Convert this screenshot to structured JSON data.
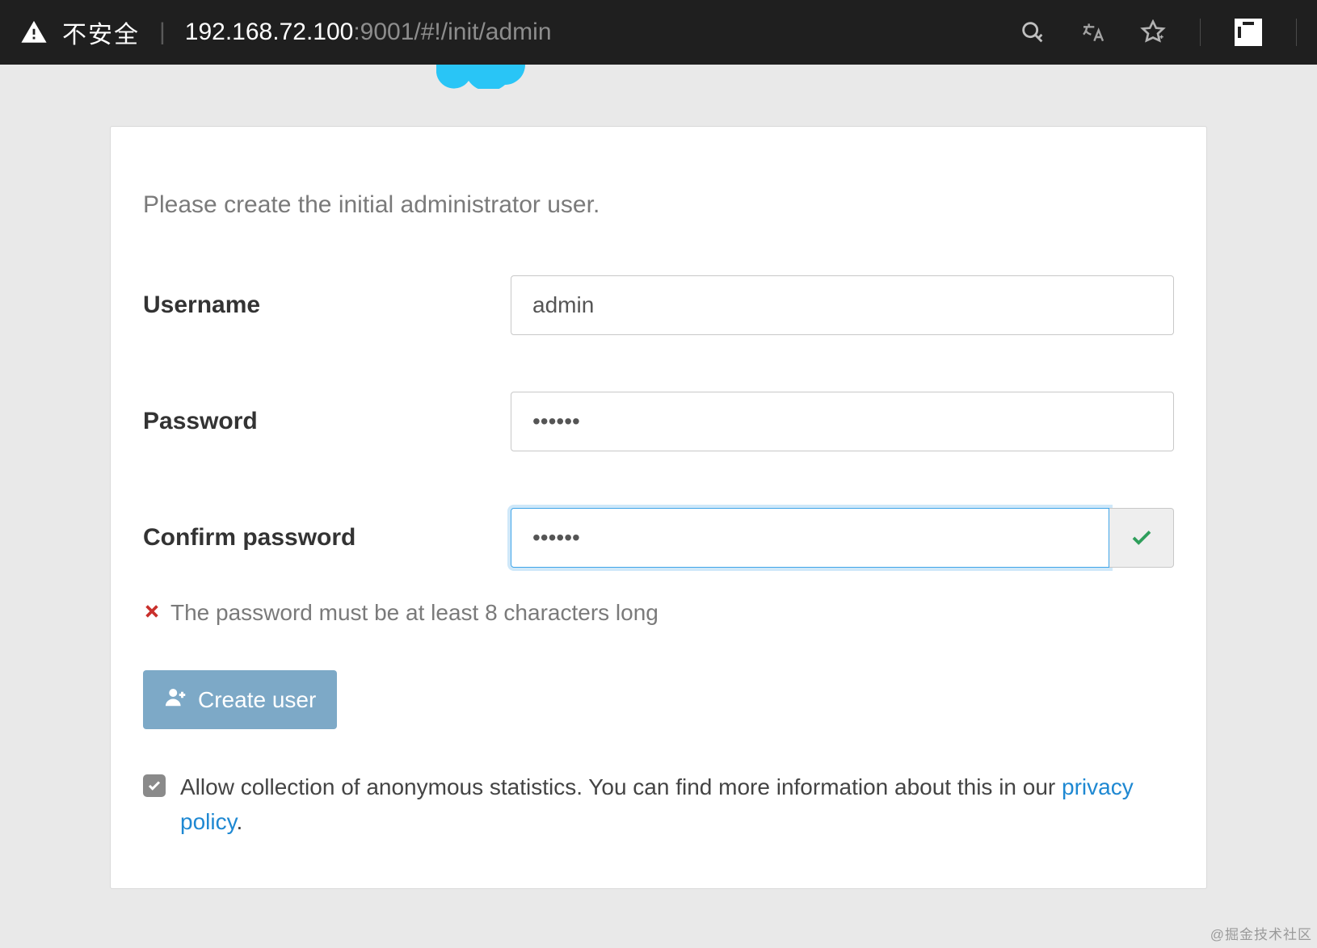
{
  "browser": {
    "security_label": "不安全",
    "url_host": "192.168.72.100",
    "url_port_path": ":9001/#!/init/admin"
  },
  "form": {
    "intro": "Please create the initial administrator user.",
    "username_label": "Username",
    "username_value": "admin",
    "password_label": "Password",
    "password_value": "••••••",
    "confirm_label": "Confirm password",
    "confirm_value": "••••••",
    "error_text": "The password must be at least 8 characters long",
    "submit_label": "Create user",
    "stats_text_1": "Allow collection of anonymous statistics. You can find more information about this in our ",
    "stats_link": "privacy policy",
    "stats_text_2": "."
  },
  "watermark": "@掘金技术社区"
}
